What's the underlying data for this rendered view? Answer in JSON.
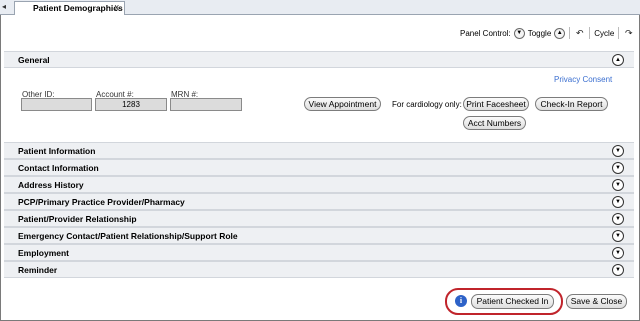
{
  "tab": {
    "title": "Patient Demographics",
    "close": "x"
  },
  "panel_control": {
    "label": "Panel Control:",
    "toggle_label": "Toggle",
    "cycle_label": "Cycle"
  },
  "general": {
    "title": "General",
    "privacy_link": "Privacy Consent",
    "other_id_label": "Other ID:",
    "other_id_value": "",
    "account_label": "Account #:",
    "account_value": "1283",
    "mrn_label": "MRN #:",
    "mrn_value": "",
    "view_appointment": "View Appointment",
    "cardiology_label": "For cardiology only:",
    "print_facesheet": "Print Facesheet",
    "check_in_report": "Check-In Report",
    "acct_numbers": "Acct Numbers"
  },
  "sections": [
    {
      "label": "Patient Information"
    },
    {
      "label": "Contact Information"
    },
    {
      "label": "Address History"
    },
    {
      "label": "PCP/Primary Practice Provider/Pharmacy"
    },
    {
      "label": "Patient/Provider Relationship"
    },
    {
      "label": "Emergency Contact/Patient Relationship/Support Role"
    },
    {
      "label": "Employment"
    },
    {
      "label": "Reminder"
    }
  ],
  "footer": {
    "info_icon": "i",
    "patient_checked_in": "Patient Checked In",
    "save_close": "Save & Close"
  },
  "colors": {
    "highlight_ring": "#c0242b",
    "link": "#3b6fd0",
    "info": "#2d62c8"
  }
}
